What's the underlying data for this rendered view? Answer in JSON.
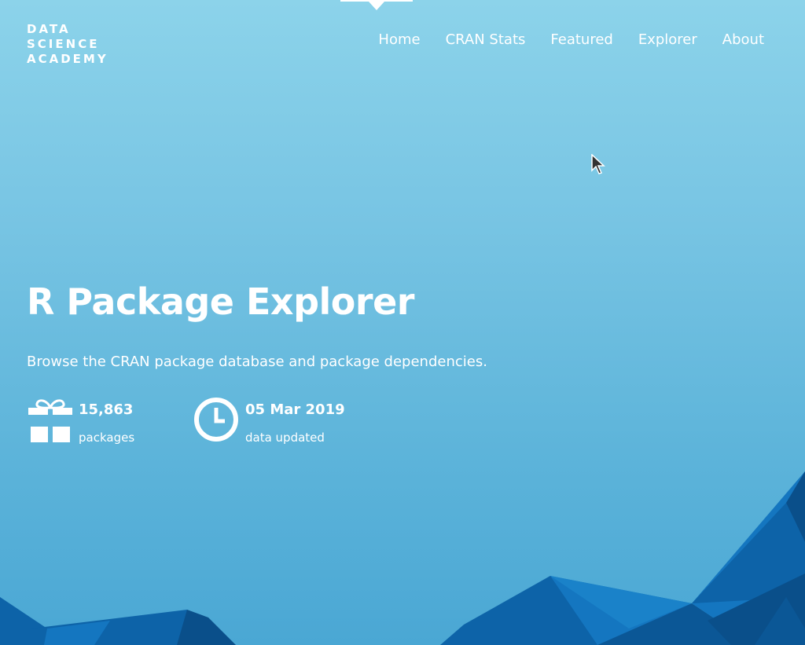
{
  "brand": {
    "logo_lines": [
      "DATA",
      "SCIENCE",
      "ACADEMY"
    ]
  },
  "nav": {
    "items": [
      {
        "label": "Home",
        "active": true
      },
      {
        "label": "CRAN Stats",
        "active": false
      },
      {
        "label": "Featured",
        "active": false
      },
      {
        "label": "Explorer",
        "active": false
      },
      {
        "label": "About",
        "active": false
      }
    ]
  },
  "hero": {
    "title": "R Package Explorer",
    "subtitle": "Browse the CRAN package database and package dependencies."
  },
  "stats": [
    {
      "icon": "gift-icon",
      "value": "15,863",
      "label": "packages"
    },
    {
      "icon": "clock-icon",
      "value": "05 Mar 2019",
      "label": "data updated"
    }
  ],
  "colors": {
    "background_top": "#8cd3ea",
    "background_bottom": "#4aa7d4",
    "text": "#ffffff",
    "mountain_dark": "#0a4f8a",
    "mountain_mid": "#0d63a8",
    "mountain_light": "#1476c0"
  }
}
